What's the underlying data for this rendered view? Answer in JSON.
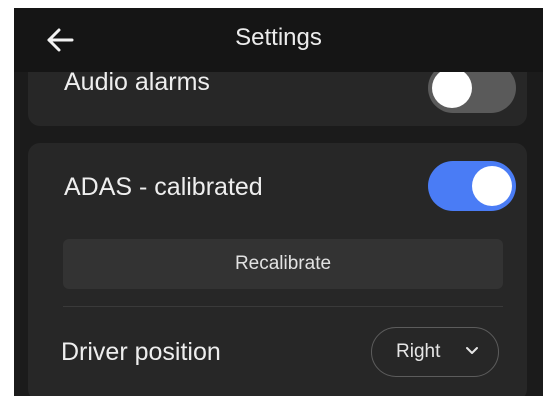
{
  "header": {
    "title": "Settings",
    "back_icon": "arrow-left-icon"
  },
  "settings": {
    "audio_alarms": {
      "label": "Audio alarms",
      "enabled": false
    },
    "adas": {
      "label": "ADAS - calibrated",
      "enabled": true,
      "recalibrate_label": "Recalibrate"
    },
    "driver_position": {
      "label": "Driver position",
      "value": "Right",
      "icon": "chevron-down-icon"
    }
  },
  "colors": {
    "background": "#1b1b1b",
    "card": "#272727",
    "toggle_on": "#4a7cf5",
    "toggle_off": "#5a5a5a"
  }
}
